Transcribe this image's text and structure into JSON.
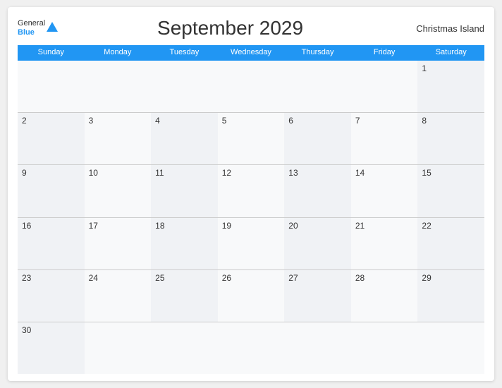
{
  "header": {
    "logo_general": "General",
    "logo_blue": "Blue",
    "title": "September 2029",
    "location": "Christmas Island"
  },
  "days_of_week": [
    "Sunday",
    "Monday",
    "Tuesday",
    "Wednesday",
    "Thursday",
    "Friday",
    "Saturday"
  ],
  "weeks": [
    [
      "",
      "",
      "",
      "",
      "",
      "",
      "1"
    ],
    [
      "2",
      "3",
      "4",
      "5",
      "6",
      "7",
      "8"
    ],
    [
      "9",
      "10",
      "11",
      "12",
      "13",
      "14",
      "15"
    ],
    [
      "16",
      "17",
      "18",
      "19",
      "20",
      "21",
      "22"
    ],
    [
      "23",
      "24",
      "25",
      "26",
      "27",
      "28",
      "29"
    ],
    [
      "30",
      "",
      "",
      "",
      "",
      "",
      ""
    ]
  ]
}
